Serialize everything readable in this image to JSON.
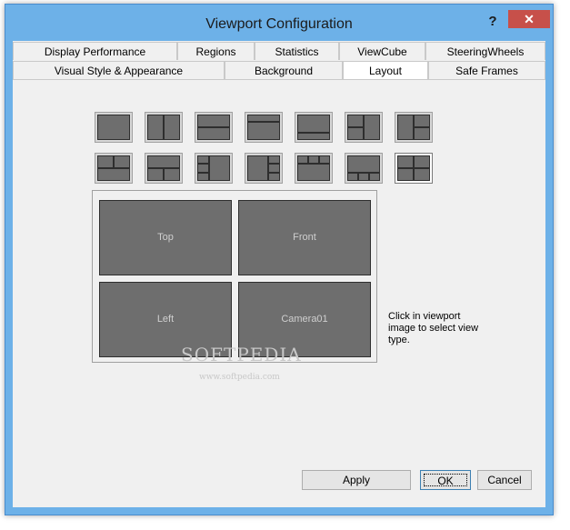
{
  "window": {
    "title": "Viewport Configuration",
    "help_glyph": "?",
    "close_glyph": "✕"
  },
  "tabs_row1": [
    "Display Performance",
    "Regions",
    "Statistics",
    "ViewCube",
    "SteeringWheels"
  ],
  "tabs_row2": [
    "Visual Style & Appearance",
    "Background",
    "Layout",
    "Safe Frames"
  ],
  "active_tab": "Layout",
  "layout": {
    "viewports": [
      "Top",
      "Front",
      "Left",
      "Camera01"
    ],
    "hint": "Click in viewport image to select view type.",
    "selected_thumbnail_index": 13
  },
  "buttons": {
    "apply": "Apply",
    "ok": "OK",
    "cancel": "Cancel"
  },
  "watermark": {
    "text": "SOFTPEDIA",
    "url": "www.softpedia.com"
  }
}
